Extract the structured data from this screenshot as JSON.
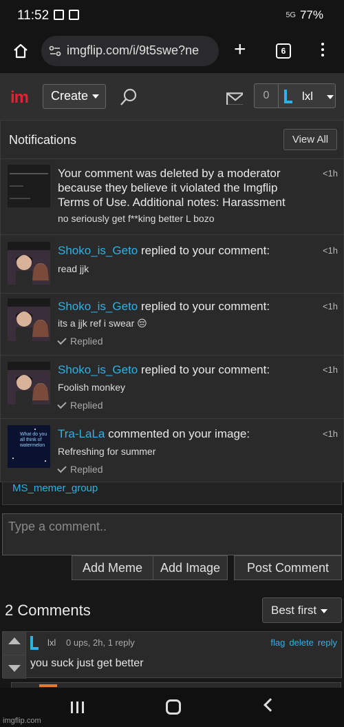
{
  "status_bar": {
    "time": "11:52",
    "network": "5G",
    "battery": "77%"
  },
  "browser": {
    "url": "imgflip.com/i/9t5swe?ne",
    "tab_count": "6"
  },
  "site_header": {
    "logo": "im",
    "create_label": "Create",
    "notification_count": "0",
    "username": "lxl"
  },
  "notifications": {
    "title": "Notifications",
    "view_all_label": "View All",
    "items": [
      {
        "user": "",
        "action": "Your comment was deleted by a moderator because they believe it violated the Imgflip Terms of Use. Additional notes: Harassment",
        "subtext": "no seriously get f**king better L bozo",
        "time": "<1h",
        "replied": ""
      },
      {
        "user": "Shoko_is_Geto",
        "action": " replied to your comment:",
        "subtext": "read jjk",
        "time": "<1h",
        "replied": ""
      },
      {
        "user": "Shoko_is_Geto",
        "action": " replied to your comment:",
        "subtext": "its a jjk ref i swear 😔",
        "time": "<1h",
        "replied": "Replied"
      },
      {
        "user": "Shoko_is_Geto",
        "action": " replied to your comment:",
        "subtext": "Foolish monkey",
        "time": "<1h",
        "replied": "Replied"
      },
      {
        "user": "Tra-LaLa",
        "action": " commented on your image:",
        "subtext": "Refreshing for summer",
        "time": "<1h",
        "replied": "Replied",
        "thumb_text": "What do you all think of watermelon"
      }
    ]
  },
  "group_link": "MS_memer_group",
  "comment_box": {
    "placeholder": "Type a comment..",
    "add_meme_label": "Add Meme",
    "add_image_label": "Add Image",
    "post_label": "Post Comment"
  },
  "comments": {
    "count_label": "2 Comments",
    "sort_label": "Best first",
    "items": [
      {
        "user": "lxl",
        "meta": "0 ups, 2h, 1 reply",
        "flag": "flag",
        "delete": "delete",
        "reply": "reply",
        "text": "you suck just get better"
      }
    ]
  },
  "watermark": "imgflip.com",
  "colors": {
    "accent": "#2fb1e6",
    "brand": "#e62132",
    "background": "#171717"
  }
}
